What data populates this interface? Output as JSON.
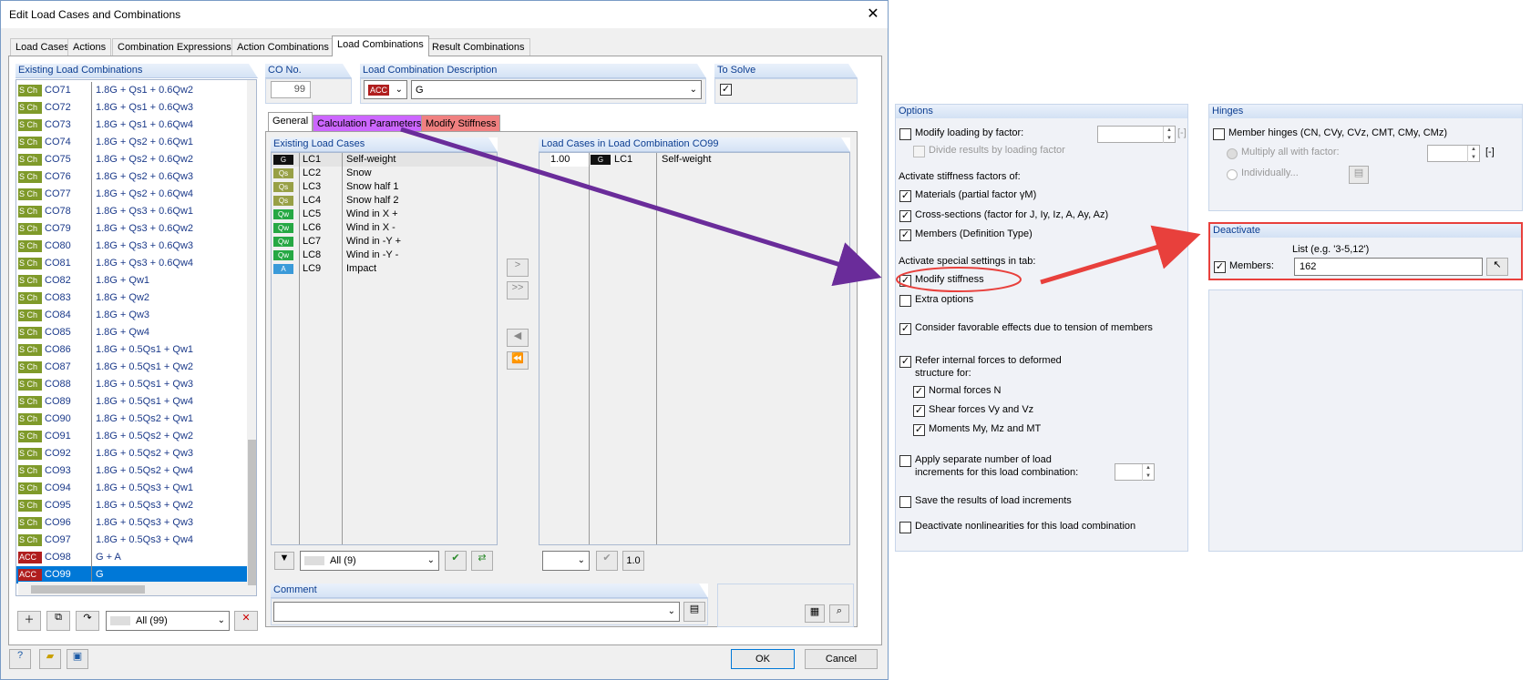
{
  "dialog": {
    "title": "Edit Load Cases and Combinations",
    "tabs": [
      "Load Cases",
      "Actions",
      "Combination Expressions",
      "Action Combinations",
      "Load Combinations",
      "Result Combinations"
    ],
    "active_tab": "Load Combinations"
  },
  "existing_combos": {
    "header": "Existing Load Combinations",
    "rows": [
      {
        "badge": "S Ch",
        "no": "CO71",
        "expr": "1.8G + Qs1 + 0.6Qw2"
      },
      {
        "badge": "S Ch",
        "no": "CO72",
        "expr": "1.8G + Qs1 + 0.6Qw3"
      },
      {
        "badge": "S Ch",
        "no": "CO73",
        "expr": "1.8G + Qs1 + 0.6Qw4"
      },
      {
        "badge": "S Ch",
        "no": "CO74",
        "expr": "1.8G + Qs2 + 0.6Qw1"
      },
      {
        "badge": "S Ch",
        "no": "CO75",
        "expr": "1.8G + Qs2 + 0.6Qw2"
      },
      {
        "badge": "S Ch",
        "no": "CO76",
        "expr": "1.8G + Qs2 + 0.6Qw3"
      },
      {
        "badge": "S Ch",
        "no": "CO77",
        "expr": "1.8G + Qs2 + 0.6Qw4"
      },
      {
        "badge": "S Ch",
        "no": "CO78",
        "expr": "1.8G + Qs3 + 0.6Qw1"
      },
      {
        "badge": "S Ch",
        "no": "CO79",
        "expr": "1.8G + Qs3 + 0.6Qw2"
      },
      {
        "badge": "S Ch",
        "no": "CO80",
        "expr": "1.8G + Qs3 + 0.6Qw3"
      },
      {
        "badge": "S Ch",
        "no": "CO81",
        "expr": "1.8G + Qs3 + 0.6Qw4"
      },
      {
        "badge": "S Ch",
        "no": "CO82",
        "expr": "1.8G + Qw1"
      },
      {
        "badge": "S Ch",
        "no": "CO83",
        "expr": "1.8G + Qw2"
      },
      {
        "badge": "S Ch",
        "no": "CO84",
        "expr": "1.8G + Qw3"
      },
      {
        "badge": "S Ch",
        "no": "CO85",
        "expr": "1.8G + Qw4"
      },
      {
        "badge": "S Ch",
        "no": "CO86",
        "expr": "1.8G + 0.5Qs1 + Qw1"
      },
      {
        "badge": "S Ch",
        "no": "CO87",
        "expr": "1.8G + 0.5Qs1 + Qw2"
      },
      {
        "badge": "S Ch",
        "no": "CO88",
        "expr": "1.8G + 0.5Qs1 + Qw3"
      },
      {
        "badge": "S Ch",
        "no": "CO89",
        "expr": "1.8G + 0.5Qs1 + Qw4"
      },
      {
        "badge": "S Ch",
        "no": "CO90",
        "expr": "1.8G + 0.5Qs2 + Qw1"
      },
      {
        "badge": "S Ch",
        "no": "CO91",
        "expr": "1.8G + 0.5Qs2 + Qw2"
      },
      {
        "badge": "S Ch",
        "no": "CO92",
        "expr": "1.8G + 0.5Qs2 + Qw3"
      },
      {
        "badge": "S Ch",
        "no": "CO93",
        "expr": "1.8G + 0.5Qs2 + Qw4"
      },
      {
        "badge": "S Ch",
        "no": "CO94",
        "expr": "1.8G + 0.5Qs3 + Qw1"
      },
      {
        "badge": "S Ch",
        "no": "CO95",
        "expr": "1.8G + 0.5Qs3 + Qw2"
      },
      {
        "badge": "S Ch",
        "no": "CO96",
        "expr": "1.8G + 0.5Qs3 + Qw3"
      },
      {
        "badge": "S Ch",
        "no": "CO97",
        "expr": "1.8G + 0.5Qs3 + Qw4"
      },
      {
        "badge": "ACC",
        "no": "CO98",
        "expr": "G + A"
      },
      {
        "badge": "ACC",
        "no": "CO99",
        "expr": "G"
      }
    ],
    "selected": "CO99",
    "filter": "All (99)"
  },
  "colors": {
    "sch": "#7f9a2a",
    "acc": "#b01e1e",
    "g": "#111111",
    "qs": "#98a046",
    "qw": "#26a844",
    "a": "#3a9ad9",
    "accent_purple": "#6a2c9a",
    "accent_red": "#e8403c",
    "select": "#0078d7"
  },
  "co_no": {
    "label": "CO No.",
    "value": "99"
  },
  "description": {
    "label": "Load Combination Description",
    "type": "ACC",
    "value": "G"
  },
  "to_solve": {
    "label": "To Solve",
    "checked": "✓"
  },
  "sub_tabs": [
    "General",
    "Calculation Parameters",
    "Modify Stiffness"
  ],
  "existing_lc": {
    "header": "Existing Load Cases",
    "rows": [
      {
        "badge": "G",
        "no": "LC1",
        "name": "Self-weight"
      },
      {
        "badge": "Qs",
        "no": "LC2",
        "name": "Snow"
      },
      {
        "badge": "Qs",
        "no": "LC3",
        "name": "Snow half 1"
      },
      {
        "badge": "Qs",
        "no": "LC4",
        "name": "Snow half 2"
      },
      {
        "badge": "Qw",
        "no": "LC5",
        "name": "Wind in X +"
      },
      {
        "badge": "Qw",
        "no": "LC6",
        "name": "Wind in X -"
      },
      {
        "badge": "Qw",
        "no": "LC7",
        "name": "Wind in -Y +"
      },
      {
        "badge": "Qw",
        "no": "LC8",
        "name": "Wind in -Y -"
      },
      {
        "badge": "A",
        "no": "LC9",
        "name": "Impact"
      }
    ],
    "filter": "All (9)"
  },
  "in_combo": {
    "header": "Load Cases in Load Combination CO99",
    "rows": [
      {
        "factor": "1.00",
        "badge": "G",
        "no": "LC1",
        "name": "Self-weight"
      }
    ],
    "factor_btn": "1.0"
  },
  "comment": {
    "label": "Comment",
    "value": ""
  },
  "buttons": {
    "ok": "OK",
    "cancel": "Cancel"
  },
  "options": {
    "header": "Options",
    "modify_loading": "Modify loading by factor:",
    "unit_bracket": "[-]",
    "divide_results": "Divide results by loading factor",
    "activate_stiffness": "Activate stiffness factors of:",
    "materials": "Materials (partial factor γM)",
    "cross_sections": "Cross-sections (factor for J, Iy, Iz, A, Ay, Az)",
    "members_def": "Members (Definition Type)",
    "activate_special": "Activate special settings in tab:",
    "modify_stiffness": "Modify stiffness",
    "extra_options": "Extra options",
    "favorable": "Consider favorable effects due to tension of members",
    "refer_internal_1": "Refer internal forces to deformed",
    "refer_internal_2": "structure for:",
    "normal_forces": "Normal forces N",
    "shear_forces": "Shear forces Vy and Vz",
    "moments": "Moments My, Mz and MT",
    "apply_sep_1": "Apply separate number of load",
    "apply_sep_2": "increments for this load combination:",
    "save_results": "Save the results of load increments",
    "deactivate_nl": "Deactivate nonlinearities for this load combination",
    "check": "✓"
  },
  "hinges": {
    "header": "Hinges",
    "member_hinges": "Member hinges (CN, CVy, CVz, CMT, CMy, CMz)",
    "multiply_all": "Multiply all with factor:",
    "unit_bracket": "[-]",
    "individually": "Individually..."
  },
  "deactivate": {
    "header": "Deactivate",
    "list_label": "List (e.g. '3-5,12')",
    "members_label": "Members:",
    "members_value": "162",
    "check": "✓"
  }
}
